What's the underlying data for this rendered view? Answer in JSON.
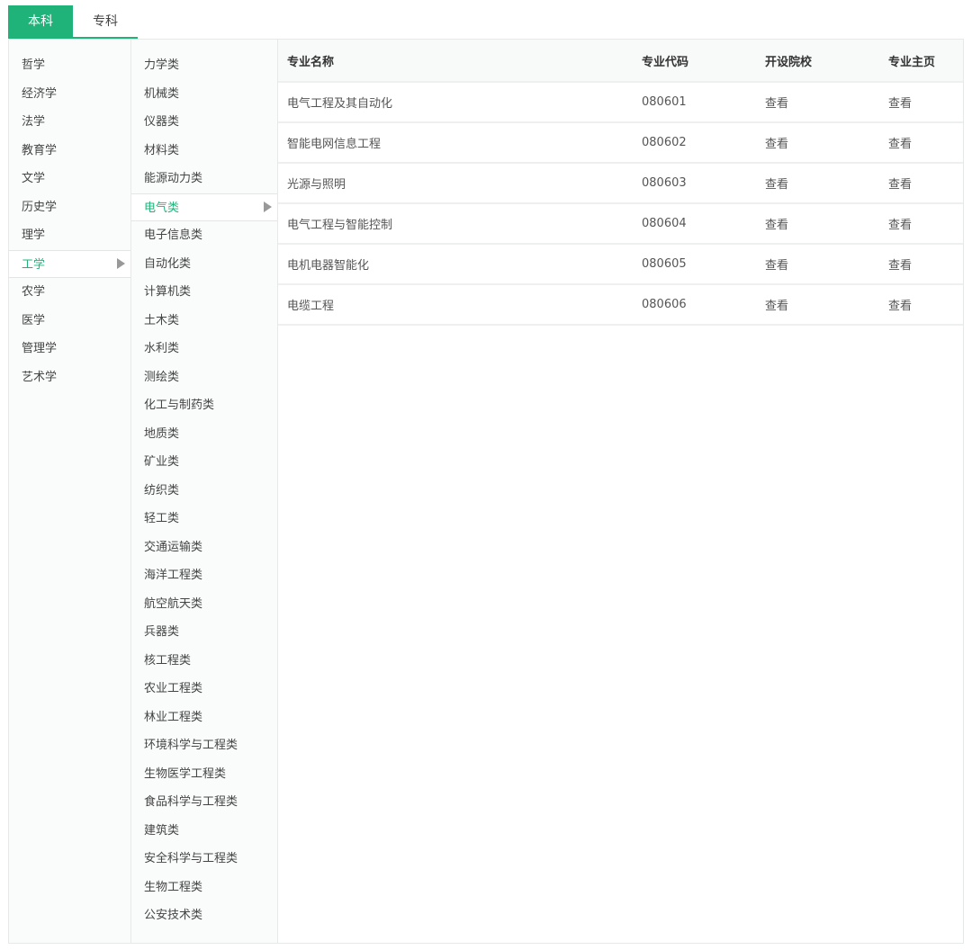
{
  "tabs": [
    {
      "label": "本科",
      "active": true
    },
    {
      "label": "专科",
      "active": false
    }
  ],
  "disciplines": [
    "哲学",
    "经济学",
    "法学",
    "教育学",
    "文学",
    "历史学",
    "理学",
    "工学",
    "农学",
    "医学",
    "管理学",
    "艺术学"
  ],
  "active_discipline": "工学",
  "categories": [
    "力学类",
    "机械类",
    "仪器类",
    "材料类",
    "能源动力类",
    "电气类",
    "电子信息类",
    "自动化类",
    "计算机类",
    "土木类",
    "水利类",
    "测绘类",
    "化工与制药类",
    "地质类",
    "矿业类",
    "纺织类",
    "轻工类",
    "交通运输类",
    "海洋工程类",
    "航空航天类",
    "兵器类",
    "核工程类",
    "农业工程类",
    "林业工程类",
    "环境科学与工程类",
    "生物医学工程类",
    "食品科学与工程类",
    "建筑类",
    "安全科学与工程类",
    "生物工程类",
    "公安技术类"
  ],
  "active_category": "电气类",
  "table": {
    "headers": [
      "专业名称",
      "专业代码",
      "开设院校",
      "专业主页"
    ],
    "rows": [
      {
        "name": "电气工程及其自动化",
        "code": "080601",
        "schools": "查看",
        "homepage": "查看"
      },
      {
        "name": "智能电网信息工程",
        "code": "080602",
        "schools": "查看",
        "homepage": "查看"
      },
      {
        "name": "光源与照明",
        "code": "080603",
        "schools": "查看",
        "homepage": "查看"
      },
      {
        "name": "电气工程与智能控制",
        "code": "080604",
        "schools": "查看",
        "homepage": "查看"
      },
      {
        "name": "电机电器智能化",
        "code": "080605",
        "schools": "查看",
        "homepage": "查看"
      },
      {
        "name": "电缆工程",
        "code": "080606",
        "schools": "查看",
        "homepage": "查看"
      }
    ]
  },
  "colors": {
    "accent": "#1fb37a"
  }
}
